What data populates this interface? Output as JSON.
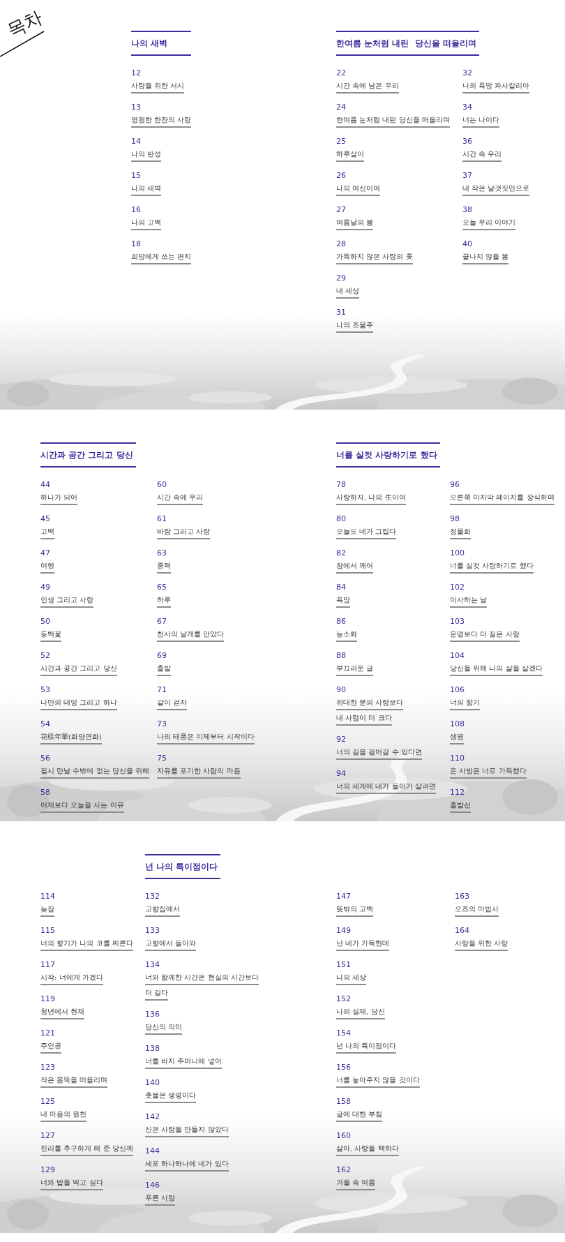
{
  "heading": "목차",
  "sections": [
    {
      "halves": [
        {
          "columns": [
            {
              "title": "나의 새벽",
              "entries": [
                {
                  "page": "12",
                  "lines": [
                    "사랑을 위한 서시"
                  ]
                },
                {
                  "page": "13",
                  "lines": [
                    "영원한 한잔의 사랑"
                  ]
                },
                {
                  "page": "14",
                  "lines": [
                    "나의 반성"
                  ]
                },
                {
                  "page": "15",
                  "lines": [
                    "나의 새벽"
                  ]
                },
                {
                  "page": "16",
                  "lines": [
                    "나의 고백"
                  ]
                },
                {
                  "page": "18",
                  "lines": [
                    "희망에게 쓰는 편지"
                  ]
                }
              ]
            }
          ]
        },
        {
          "columns": [
            {
              "title": "한여름 눈처럼 내린  당신을 떠올리며",
              "entries": [
                {
                  "page": "22",
                  "lines": [
                    "시간 속에 남은 우리"
                  ]
                },
                {
                  "page": "24",
                  "lines": [
                    "한여름 눈처럼 내린 당신을 떠올리며"
                  ]
                },
                {
                  "page": "25",
                  "lines": [
                    "하루살이"
                  ]
                },
                {
                  "page": "26",
                  "lines": [
                    "나의 여신이여"
                  ]
                },
                {
                  "page": "27",
                  "lines": [
                    "여름날의 봄"
                  ]
                },
                {
                  "page": "28",
                  "lines": [
                    "가득하지 않은 사랑의 美"
                  ]
                },
                {
                  "page": "29",
                  "lines": [
                    "내 세상"
                  ]
                },
                {
                  "page": "31",
                  "lines": [
                    "나의 조물주"
                  ]
                }
              ]
            },
            {
              "entries": [
                {
                  "page": "32",
                  "lines": [
                    "나의 욕망 파사칼리아"
                  ]
                },
                {
                  "page": "34",
                  "lines": [
                    "너는 나이다"
                  ]
                },
                {
                  "page": "36",
                  "lines": [
                    "시간 속 우리"
                  ]
                },
                {
                  "page": "37",
                  "lines": [
                    "내 작은 날갯짓만으로"
                  ]
                },
                {
                  "page": "38",
                  "lines": [
                    "오늘 우리 이야기"
                  ]
                },
                {
                  "page": "40",
                  "lines": [
                    "끝나지 않을 봄"
                  ]
                }
              ]
            }
          ]
        }
      ]
    },
    {
      "halves": [
        {
          "columns": [
            {
              "title": "시간과 공간 그리고 당신",
              "entries": [
                {
                  "page": "44",
                  "lines": [
                    "하나가 되어"
                  ]
                },
                {
                  "page": "45",
                  "lines": [
                    "고백"
                  ]
                },
                {
                  "page": "47",
                  "lines": [
                    "여행"
                  ]
                },
                {
                  "page": "49",
                  "lines": [
                    "인생 그리고 사랑"
                  ]
                },
                {
                  "page": "50",
                  "lines": [
                    "동백꽃"
                  ]
                },
                {
                  "page": "52",
                  "lines": [
                    "시간과 공간 그리고 당신"
                  ]
                },
                {
                  "page": "53",
                  "lines": [
                    "나만의 태양 그리고 하나"
                  ]
                },
                {
                  "page": "54",
                  "lines": [
                    "花樣年華(화양연화)"
                  ]
                },
                {
                  "page": "56",
                  "lines": [
                    "필시 만날 수밖에 없는 당신을 위해"
                  ]
                },
                {
                  "page": "58",
                  "lines": [
                    "어제보다 오늘을 사는 이유"
                  ]
                }
              ]
            },
            {
              "entries": [
                {
                  "page": "60",
                  "lines": [
                    "시간 속에 우리"
                  ]
                },
                {
                  "page": "61",
                  "lines": [
                    "바람 그리고 사랑"
                  ]
                },
                {
                  "page": "63",
                  "lines": [
                    "중력"
                  ]
                },
                {
                  "page": "65",
                  "lines": [
                    "하루"
                  ]
                },
                {
                  "page": "67",
                  "lines": [
                    "천사의 날개를 안았다"
                  ]
                },
                {
                  "page": "69",
                  "lines": [
                    "출발"
                  ]
                },
                {
                  "page": "71",
                  "lines": [
                    "같이 걷자"
                  ]
                },
                {
                  "page": "73",
                  "lines": [
                    "나의 태풍은 이제부터 시작이다"
                  ]
                },
                {
                  "page": "75",
                  "lines": [
                    "자유를 포기한 사람의 마음"
                  ]
                }
              ]
            }
          ]
        },
        {
          "columns": [
            {
              "title": "너를 실컷 사랑하기로 했다",
              "entries": [
                {
                  "page": "78",
                  "lines": [
                    "사랑하자, 나의 生이여"
                  ]
                },
                {
                  "page": "80",
                  "lines": [
                    "오늘도 네가 그립다"
                  ]
                },
                {
                  "page": "82",
                  "lines": [
                    "잠에서 깨어"
                  ]
                },
                {
                  "page": "84",
                  "lines": [
                    "욕망"
                  ]
                },
                {
                  "page": "86",
                  "lines": [
                    "능소화"
                  ]
                },
                {
                  "page": "88",
                  "lines": [
                    "부끄러운 글"
                  ]
                },
                {
                  "page": "90",
                  "lines": [
                    "위대한 분의 사랑보다",
                    "내 사랑이 더 크다"
                  ]
                },
                {
                  "page": "92",
                  "lines": [
                    "너의 길을 걸어갈 수 있다면"
                  ]
                },
                {
                  "page": "94",
                  "lines": [
                    "너의 세계에 내가 들어가 살려면"
                  ]
                }
              ]
            },
            {
              "entries": [
                {
                  "page": "96",
                  "lines": [
                    "오른쪽 마지막 페이지를 장식하며"
                  ]
                },
                {
                  "page": "98",
                  "lines": [
                    "정물화"
                  ]
                },
                {
                  "page": "100",
                  "lines": [
                    "너를 실컷 사랑하기로 했다"
                  ]
                },
                {
                  "page": "102",
                  "lines": [
                    "이사하는 날"
                  ]
                },
                {
                  "page": "103",
                  "lines": [
                    "운명보다 더 질은 사랑"
                  ]
                },
                {
                  "page": "104",
                  "lines": [
                    "당신을 위해 나의 삶을 살겠다"
                  ]
                },
                {
                  "page": "106",
                  "lines": [
                    "너의 향기"
                  ]
                },
                {
                  "page": "108",
                  "lines": [
                    "생명"
                  ]
                },
                {
                  "page": "110",
                  "lines": [
                    "온 사방은 너로 가득했다"
                  ]
                },
                {
                  "page": "112",
                  "lines": [
                    "출발선"
                  ]
                }
              ]
            }
          ]
        }
      ]
    },
    {
      "halves": [
        {
          "columns": [
            {
              "entries": [
                {
                  "page": "114",
                  "lines": [
                    "늦잠"
                  ]
                },
                {
                  "page": "115",
                  "lines": [
                    "너의 향기가 나의 코를 찌른다"
                  ]
                },
                {
                  "page": "117",
                  "lines": [
                    "시작: 너에게 가겠다"
                  ]
                },
                {
                  "page": "119",
                  "lines": [
                    "청년에서 현재"
                  ]
                },
                {
                  "page": "121",
                  "lines": [
                    "주인공"
                  ]
                },
                {
                  "page": "123",
                  "lines": [
                    "작은 몸뚝을 떠올리며"
                  ]
                },
                {
                  "page": "125",
                  "lines": [
                    "내 마음의 원천"
                  ]
                },
                {
                  "page": "127",
                  "lines": [
                    "진리를 추구하게 해 준 당신께"
                  ]
                },
                {
                  "page": "129",
                  "lines": [
                    "너와 밥을 먹고 싶다"
                  ]
                }
              ]
            },
            {
              "title": "넌 나의 특이점이다",
              "entries": [
                {
                  "page": "132",
                  "lines": [
                    "고향집에서"
                  ]
                },
                {
                  "page": "133",
                  "lines": [
                    "고향에서 돌아와"
                  ]
                },
                {
                  "page": "134",
                  "lines": [
                    "너와 함께한 시간은 현실의 시간보다",
                    "더 길다"
                  ]
                },
                {
                  "page": "136",
                  "lines": [
                    "당신의 의미"
                  ]
                },
                {
                  "page": "138",
                  "lines": [
                    "너를 바지 주머니에 넣어"
                  ]
                },
                {
                  "page": "140",
                  "lines": [
                    "촛불은 생명이다"
                  ]
                },
                {
                  "page": "142",
                  "lines": [
                    "신은 사랑을 만들지 않았다"
                  ]
                },
                {
                  "page": "144",
                  "lines": [
                    "세포 하나하나에 네가 있다"
                  ]
                },
                {
                  "page": "146",
                  "lines": [
                    "푸른 사랑"
                  ]
                }
              ]
            }
          ]
        },
        {
          "columns": [
            {
              "entries": [
                {
                  "page": "147",
                  "lines": [
                    "뜻밖의 고백"
                  ]
                },
                {
                  "page": "149",
                  "lines": [
                    "난 네가 가득한데"
                  ]
                },
                {
                  "page": "151",
                  "lines": [
                    "나의 세상"
                  ]
                },
                {
                  "page": "152",
                  "lines": [
                    "나의 실재, 당신"
                  ]
                },
                {
                  "page": "154",
                  "lines": [
                    "넌 나의 특이점이다"
                  ]
                },
                {
                  "page": "156",
                  "lines": [
                    "너를 놓아주지 않을 것이다"
                  ]
                },
                {
                  "page": "158",
                  "lines": [
                    "글에 대한 부침"
                  ]
                },
                {
                  "page": "160",
                  "lines": [
                    "삶아, 사랑을 택하다"
                  ]
                },
                {
                  "page": "162",
                  "lines": [
                    "겨울 속 여름"
                  ]
                }
              ]
            },
            {
              "entries": [
                {
                  "page": "163",
                  "lines": [
                    "오즈의 마법사"
                  ]
                },
                {
                  "page": "164",
                  "lines": [
                    "사랑을 위한 사랑"
                  ]
                }
              ]
            }
          ]
        }
      ]
    }
  ]
}
